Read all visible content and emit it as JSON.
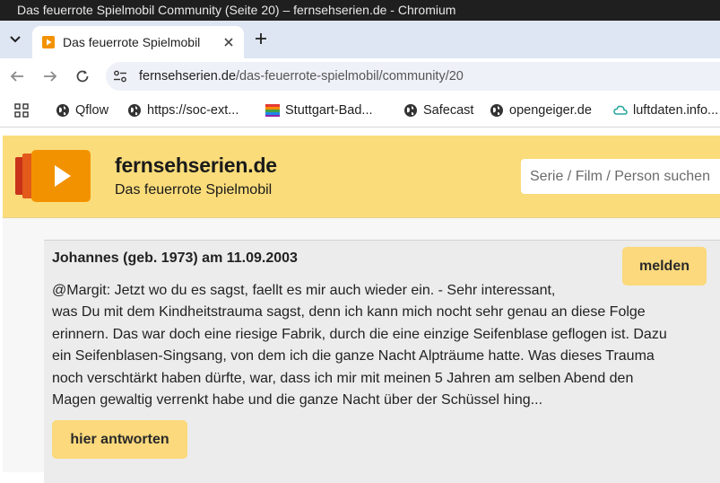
{
  "window": {
    "title": "Das feuerrote Spielmobil Community (Seite 20) – fernsehserien.de - Chromium"
  },
  "tab": {
    "title": "Das feuerrote Spielmobil",
    "favicon": "play-icon"
  },
  "address_bar": {
    "host": "fernsehserien.de",
    "path": "/das-feuerrote-spielmobil/community/20"
  },
  "bookmarks": [
    {
      "label": "Qflow",
      "icon": "globe-icon"
    },
    {
      "label": "https://soc-ext...",
      "icon": "globe-icon"
    },
    {
      "label": "Stuttgart-Bad...",
      "icon": "flag-icon"
    },
    {
      "label": "Safecast",
      "icon": "globe-icon"
    },
    {
      "label": "opengeiger.de",
      "icon": "globe-icon"
    },
    {
      "label": "luftdaten.info...",
      "icon": "cloud-icon"
    }
  ],
  "site": {
    "brand": "fernsehserien.de",
    "subtitle": "Das feuerrote Spielmobil",
    "search_placeholder": "Serie / Film / Person suchen"
  },
  "comment": {
    "header": "Johannes (geb. 1973) am 11.09.2003",
    "report_label": "melden",
    "lines": [
      "@Margit: Jetzt wo du es sagst, faellt es mir auch wieder ein. - Sehr interessant,",
      "was Du mit dem Kindheitstrauma sagst, denn ich kann mich nocht sehr genau an diese Folge",
      "erinnern. Das war doch eine riesige Fabrik, durch die eine einzige Seifenblase geflogen ist. Dazu",
      "ein Seifenblasen-Singsang, von dem ich die ganze Nacht Alpträume hatte. Was dieses Trauma",
      "noch verschtärkt haben dürfte, war, dass ich mir mit meinen 5 Jahren am selben Abend den",
      "Magen gewaltig verrenkt habe und die ganze Nacht über der Schüssel hing..."
    ],
    "reply_label": "hier antworten"
  },
  "colors": {
    "accent": "#fadc7a",
    "button": "#fbd97c",
    "logo": "#f39200"
  }
}
